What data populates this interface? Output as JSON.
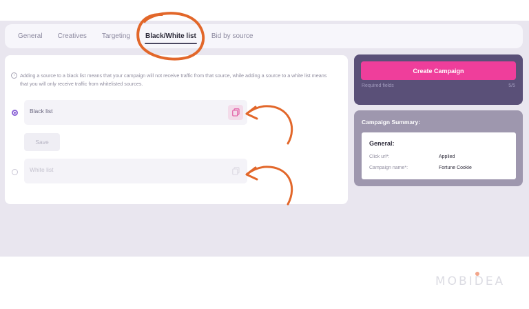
{
  "tabs": [
    {
      "label": "General",
      "active": false
    },
    {
      "label": "Creatives",
      "active": false
    },
    {
      "label": "Targeting",
      "active": false
    },
    {
      "label": "Black/White list",
      "active": true
    },
    {
      "label": "Bid by source",
      "active": false
    }
  ],
  "notice": "Adding a source to a black list means that your campaign will not receive traffic from that source, while adding a source to a white list means that you will only receive traffic from whitelisted sources.",
  "lists": {
    "black": {
      "label": "Black list",
      "selected": true,
      "copy_icon": "copy-icon"
    },
    "white": {
      "label": "White list",
      "selected": false,
      "copy_icon": "copy-icon"
    }
  },
  "save_label": "Save",
  "create": {
    "button_label": "Create Campaign",
    "required_label": "Required fields",
    "required_count": "5/5"
  },
  "summary": {
    "title": "Campaign Summary:",
    "section": "General:",
    "rows": [
      {
        "key": "Click url*:",
        "value": "Applied"
      },
      {
        "key": "Campaign name*:",
        "value": "Fortune Cookie"
      }
    ]
  },
  "watermark": "MOBIDEA",
  "colors": {
    "accent": "#ef3e9b",
    "panel_dark": "#5a5078",
    "panel_muted": "#9e97ae",
    "radio_selected": "#8b63d6",
    "annotation": "#e2672a"
  }
}
